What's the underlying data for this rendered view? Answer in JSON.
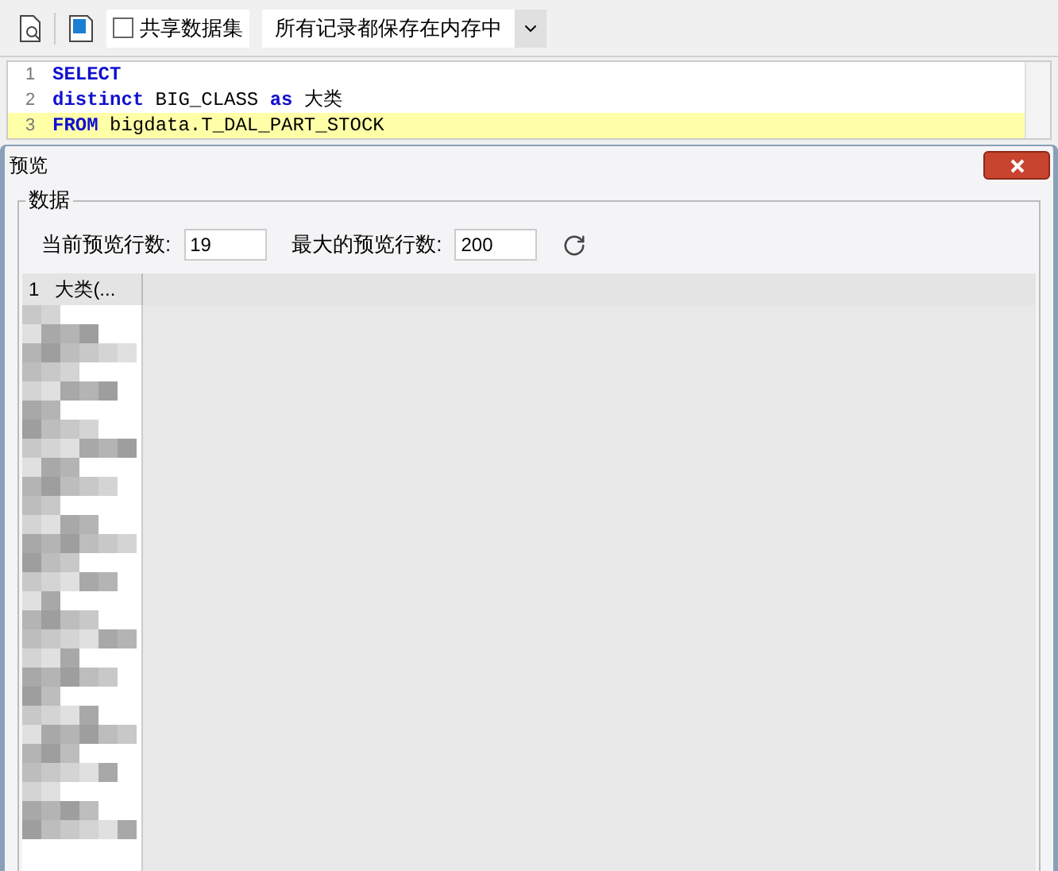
{
  "toolbar": {
    "share_dataset": {
      "label": "共享数据集",
      "checked": false
    },
    "storage_mode": {
      "value": "所有记录都保存在内存中"
    }
  },
  "editor": {
    "lines": [
      {
        "number": "1",
        "current": false,
        "tokens": [
          {
            "kind": "keyword",
            "text": "SELECT"
          }
        ]
      },
      {
        "number": "2",
        "current": false,
        "tokens": [
          {
            "kind": "keyword",
            "text": "distinct"
          },
          {
            "kind": "text",
            "text": "BIG_CLASS"
          },
          {
            "kind": "keyword",
            "text": "as"
          },
          {
            "kind": "text",
            "text": "大类"
          }
        ]
      },
      {
        "number": "3",
        "current": true,
        "tokens": [
          {
            "kind": "keyword",
            "text": "FROM"
          },
          {
            "kind": "text",
            "text": "bigdata.T_DAL_PART_STOCK"
          }
        ]
      }
    ]
  },
  "dialog": {
    "title": "预览",
    "group_label": "数据",
    "current_rows": {
      "label": "当前预览行数:",
      "value": "19"
    },
    "max_rows": {
      "label": "最大的预览行数:",
      "value": "200"
    },
    "table": {
      "columns": [
        {
          "label": "1"
        },
        {
          "label": "大类(..."
        }
      ]
    }
  }
}
